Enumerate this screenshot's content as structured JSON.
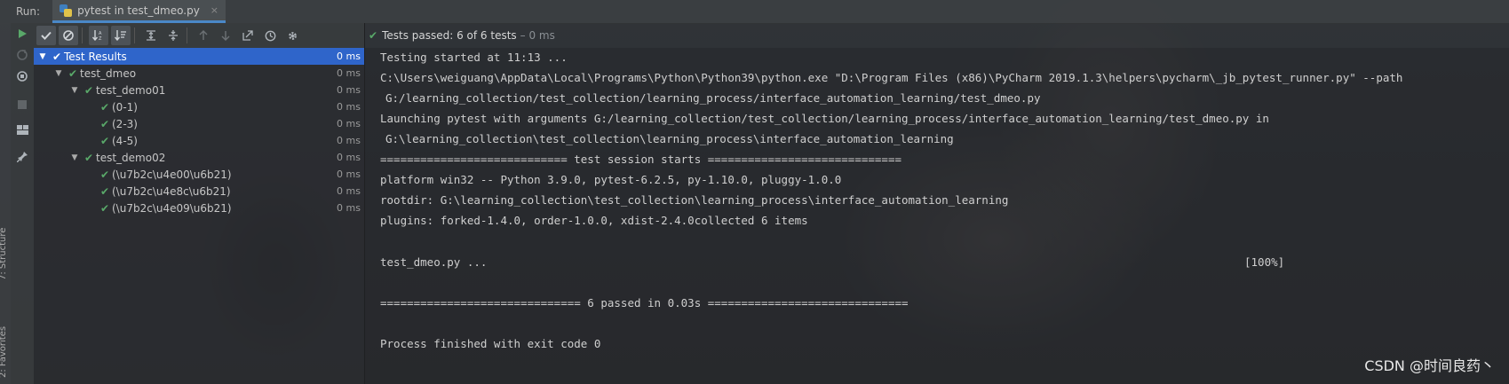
{
  "topbar": {
    "run_label": "Run:",
    "tab_title": "pytest in test_dmeo.py",
    "tab_close": "×"
  },
  "left_strip": {
    "structure_label": "7: Structure",
    "favorites_label": "2: Favorites"
  },
  "tree": {
    "rows": [
      {
        "label": "Test Results",
        "time": "0 ms"
      },
      {
        "label": "test_dmeo",
        "time": "0 ms"
      },
      {
        "label": "test_demo01",
        "time": "0 ms"
      },
      {
        "label": "(0-1)",
        "time": "0 ms"
      },
      {
        "label": "(2-3)",
        "time": "0 ms"
      },
      {
        "label": "(4-5)",
        "time": "0 ms"
      },
      {
        "label": "test_demo02",
        "time": "0 ms"
      },
      {
        "label": "(\\u7b2c\\u4e00\\u6b21)",
        "time": "0 ms"
      },
      {
        "label": "(\\u7b2c\\u4e8c\\u6b21)",
        "time": "0 ms"
      },
      {
        "label": "(\\u7b2c\\u4e09\\u6b21)",
        "time": "0 ms"
      }
    ]
  },
  "status": {
    "main": "Tests passed: 6 of 6 tests",
    "time": "– 0 ms"
  },
  "console": {
    "lines": [
      "Testing started at 11:13 ...",
      "C:\\Users\\weiguang\\AppData\\Local\\Programs\\Python\\Python39\\python.exe \"D:\\Program Files (x86)\\PyCharm 2019.1.3\\helpers\\pycharm\\_jb_pytest_runner.py\" --path",
      "G:/learning_collection/test_collection/learning_process/interface_automation_learning/test_dmeo.py",
      "Launching pytest with arguments G:/learning_collection/test_collection/learning_process/interface_automation_learning/test_dmeo.py in",
      "G:\\learning_collection\\test_collection\\learning_process\\interface_automation_learning",
      "============================ test session starts =============================",
      "platform win32 -- Python 3.9.0, pytest-6.2.5, py-1.10.0, pluggy-1.0.0",
      "rootdir: G:\\learning_collection\\test_collection\\learning_process\\interface_automation_learning",
      "plugins: forked-1.4.0, order-1.0.0, xdist-2.4.0collected 6 items",
      "test_dmeo.py ...",
      "[100%]",
      "============================== 6 passed in 0.03s ==============================",
      "Process finished with exit code 0"
    ]
  },
  "watermark": "CSDN @时间良药丶",
  "colors": {
    "pass_green": "#59a869",
    "selection_blue": "#2f65ca",
    "tab_underline": "#4a88c7"
  },
  "icons": {
    "run": "play-icon",
    "rerun": "rerun-icon",
    "stop": "stop-icon",
    "pin": "pin-icon",
    "show_passed": "check-icon",
    "show_ignored": "cancel-circle-icon",
    "sort_alpha": "sort-alpha-icon",
    "sort_duration": "sort-duration-icon",
    "expand": "expand-all-icon",
    "collapse": "collapse-all-icon",
    "prev": "arrow-up-icon",
    "next": "arrow-down-icon",
    "export": "export-icon",
    "history": "history-icon",
    "settings": "gear-icon"
  }
}
